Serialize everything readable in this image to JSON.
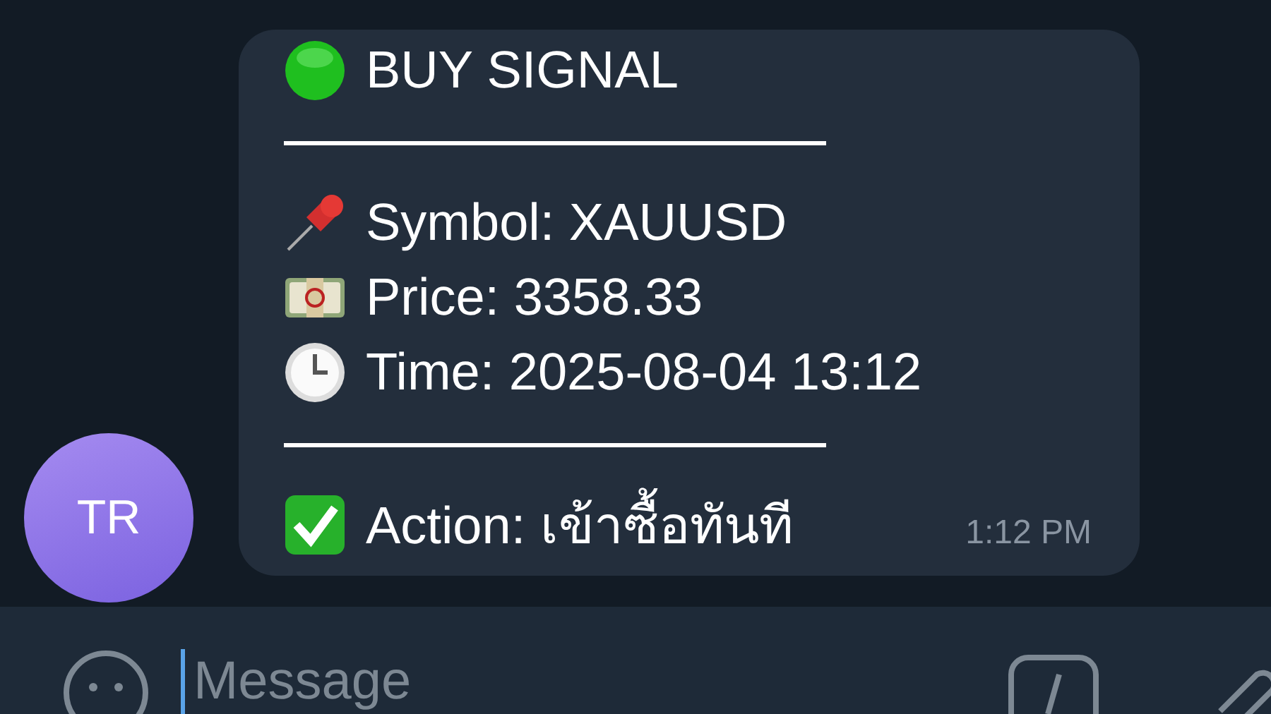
{
  "message": {
    "lines": [
      {
        "kind": "text",
        "text": "BUY SIGNAL"
      },
      {
        "kind": "rule"
      },
      {
        "kind": "text",
        "text": "Symbol: XAUUSD"
      },
      {
        "kind": "text",
        "text": "Price: 3358.33"
      },
      {
        "kind": "text",
        "text": "Time: 2025-08-04 13:12"
      },
      {
        "kind": "rule"
      },
      {
        "kind": "text",
        "text": "Action: เข้าซื้อทันที"
      }
    ],
    "time": "1:12 PM"
  },
  "sender": {
    "initials": "TR"
  },
  "composer": {
    "placeholder": "Message"
  }
}
